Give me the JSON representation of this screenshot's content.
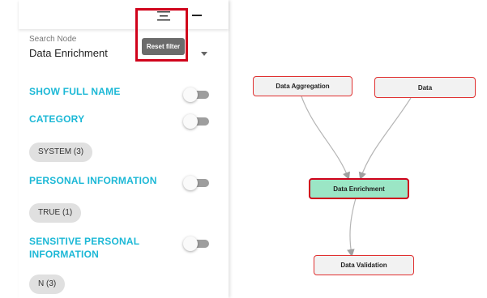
{
  "panel": {
    "search": {
      "label": "Search Node",
      "value": "Data Enrichment"
    },
    "reset_filter_label": "Reset filter",
    "sections": {
      "show_full_name": "SHOW FULL NAME",
      "category": "CATEGORY",
      "personal_information": "PERSONAL INFORMATION",
      "sensitive_personal_information_line1": "SENSITIVE PERSONAL",
      "sensitive_personal_information_line2": "INFORMATION"
    },
    "chips": {
      "category": "SYSTEM (3)",
      "personal_information": "TRUE (1)",
      "sensitive_personal_information": "N (3)"
    },
    "toggles": {
      "show_full_name": false,
      "category": false,
      "personal_information": false,
      "sensitive_personal_information": false
    },
    "icons": {
      "menu": "menu-lines-icon",
      "minimize": "minimize-icon",
      "dropdown": "chevron-down-icon"
    }
  },
  "graph": {
    "nodes": {
      "data_aggregation": "Data Aggregation",
      "data": "Data",
      "data_enrichment": "Data Enrichment",
      "data_validation": "Data Validation"
    },
    "edges": [
      {
        "from": "Data Aggregation",
        "to": "Data Enrichment"
      },
      {
        "from": "Data",
        "to": "Data Enrichment"
      },
      {
        "from": "Data Enrichment",
        "to": "Data Validation"
      }
    ]
  },
  "colors": {
    "accent": "#1cb8d6",
    "highlight": "#d0021b",
    "focus_node": "#9be6c5",
    "node_border": "#e03030"
  }
}
